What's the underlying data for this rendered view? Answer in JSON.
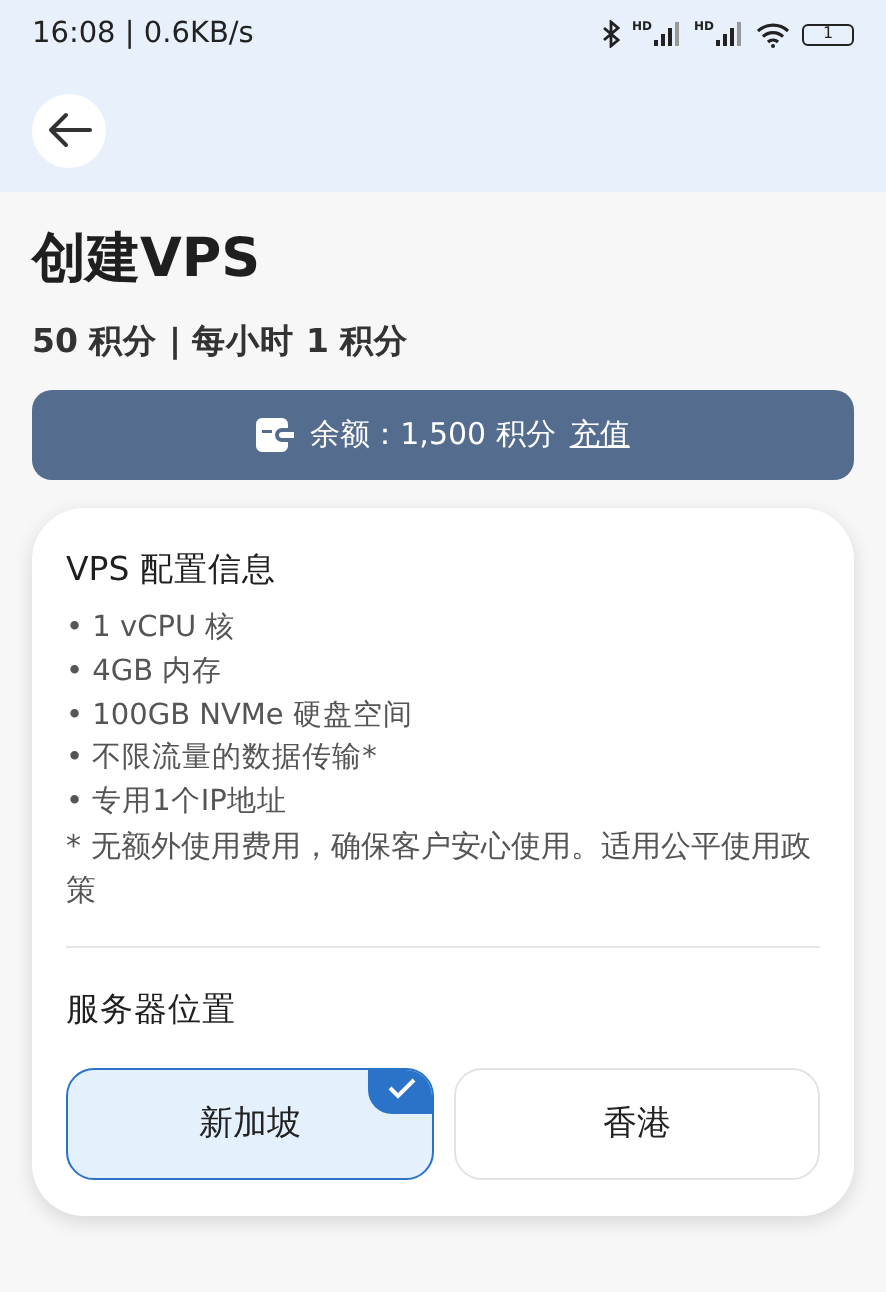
{
  "status_bar": {
    "time": "16:08 | 0.6KB/s",
    "signals": [
      {
        "badge": "HD"
      },
      {
        "badge": "HD"
      }
    ],
    "battery": "1"
  },
  "page": {
    "title": "创建VPS",
    "subtitle": "50 积分 | 每小时 1 积分"
  },
  "balance": {
    "text": "余额：1,500 积分",
    "link": "充值"
  },
  "card": {
    "title": "VPS 配置信息",
    "features": [
      "• 1 vCPU 核",
      "• 4GB 内存",
      "• 100GB NVMe 硬盘空间",
      "• 不限流量的数据传输*",
      "• 专用1个IP地址"
    ],
    "note": "* 无额外使用费用，确保客户安心使用。适用公平使用政策",
    "location_title": "服务器位置",
    "locations": [
      {
        "label": "新加坡",
        "selected": true
      },
      {
        "label": "香港",
        "selected": false
      }
    ]
  }
}
